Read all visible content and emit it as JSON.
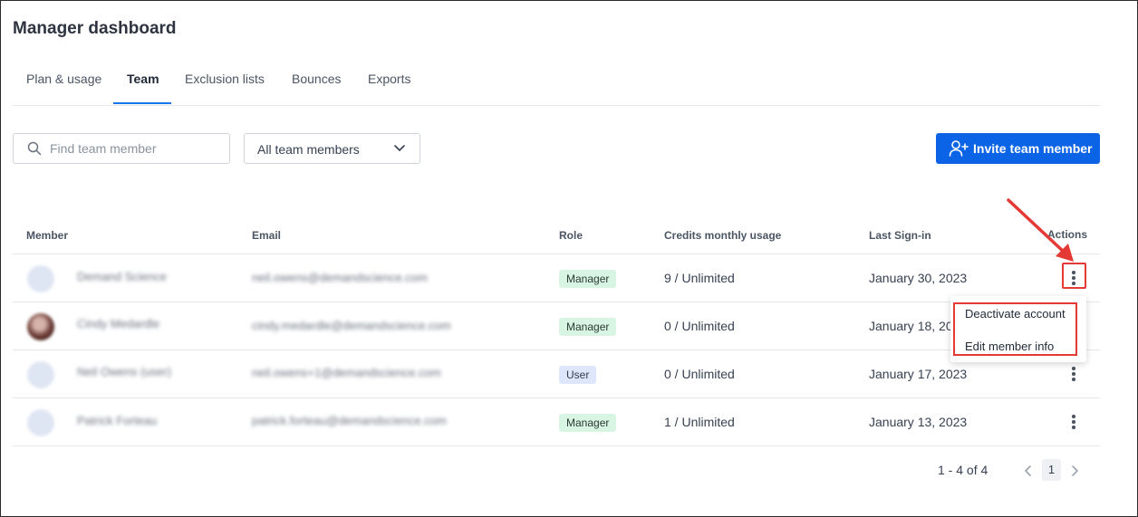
{
  "page": {
    "title": "Manager dashboard"
  },
  "tabs": [
    {
      "label": "Plan & usage"
    },
    {
      "label": "Team",
      "active": true
    },
    {
      "label": "Exclusion lists"
    },
    {
      "label": "Bounces"
    },
    {
      "label": "Exports"
    }
  ],
  "toolbar": {
    "search_placeholder": "Find team member",
    "search_value": "",
    "filter_selected": "All team members",
    "invite_label": "Invite team member"
  },
  "table": {
    "columns": [
      "Member",
      "Email",
      "Role",
      "Credits monthly usage",
      "Last Sign-in",
      "Actions"
    ],
    "rows": [
      {
        "member": "Demand Science",
        "email": "neil.owens@demandscience.com",
        "role": "Manager",
        "credits": "9 / Unlimited",
        "last_sign_in": "January 30, 2023"
      },
      {
        "member": "Cindy Medardle",
        "email": "cindy.medardle@demandscience.com",
        "role": "Manager",
        "credits": "0 / Unlimited",
        "last_sign_in": "January 18, 20"
      },
      {
        "member": "Neil Owens (user)",
        "email": "neil.owens+1@demandscience.com",
        "role": "User",
        "credits": "0 / Unlimited",
        "last_sign_in": "January 17, 2023"
      },
      {
        "member": "Patrick Forteau",
        "email": "patrick.forteau@demandscience.com",
        "role": "Manager",
        "credits": "1 / Unlimited",
        "last_sign_in": "January 13, 2023"
      }
    ]
  },
  "actions_menu": {
    "items": [
      {
        "label": "Deactivate account"
      },
      {
        "label": "Edit member info"
      }
    ]
  },
  "pagination": {
    "range_text": "1 - 4 of 4",
    "current_page": "1"
  },
  "colors": {
    "accent": "#0b63e5",
    "highlight": "#e53935",
    "manager_badge": "#d8f5e3",
    "user_badge": "#dde6fb"
  },
  "icons": [
    "search-icon",
    "chevron-down-icon",
    "add-user-icon",
    "kebab-icon",
    "chevron-left-icon",
    "chevron-right-icon",
    "annotation-arrow"
  ]
}
